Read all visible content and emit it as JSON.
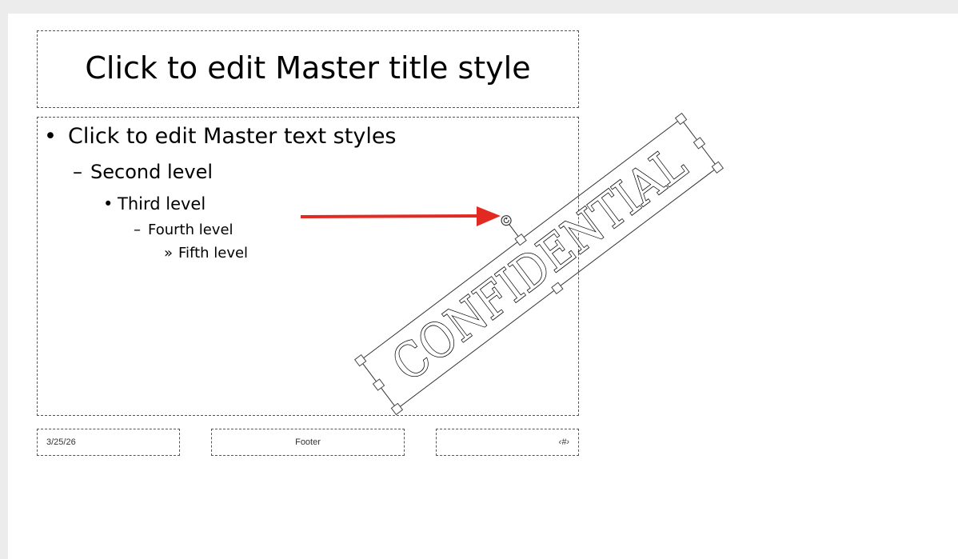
{
  "slide": {
    "title": "Click to edit Master title style",
    "levels": [
      {
        "bullet": "•",
        "text": "Click to edit Master text styles"
      },
      {
        "bullet": "–",
        "text": "Second level"
      },
      {
        "bullet": "•",
        "text": "Third level"
      },
      {
        "bullet": "–",
        "text": "Fourth level"
      },
      {
        "bullet": "»",
        "text": "Fifth level"
      }
    ],
    "date": "3/25/26",
    "footer": "Footer",
    "slide_number": "‹#›"
  },
  "watermark": {
    "text": "CONFIDENTIAL",
    "rotate_handle_icon": "rotate-icon"
  },
  "annotation": {
    "arrow_color": "#e32a22"
  },
  "colors": {
    "background": "#ececec",
    "slide": "#ffffff",
    "placeholder_border": "#555555",
    "selection_border": "#333333"
  }
}
